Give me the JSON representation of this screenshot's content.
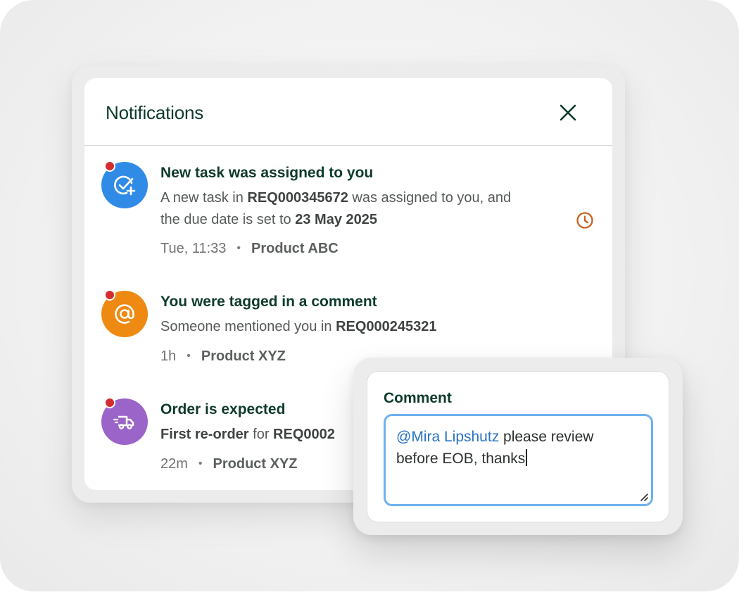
{
  "notifications_panel": {
    "title": "Notifications",
    "close_icon": "close-icon",
    "items": [
      {
        "icon": "task-check-add-icon",
        "icon_color": "#2f8be6",
        "unread": true,
        "title": "New task was assigned to you",
        "body_line1_prefix": "A new task in ",
        "body_line1_ref": "REQ000345672",
        "body_line1_suffix": " was assigned to you, and",
        "body_line2_prefix": "the due date is set to ",
        "body_line2_date": "23 May 2025",
        "time": "Tue, 11:33",
        "separator": "•",
        "product": "Product ABC",
        "status_icon": "clock-icon",
        "status_color": "#c9621c"
      },
      {
        "icon": "at-sign-icon",
        "icon_color": "#ee8a12",
        "unread": true,
        "title": "You were tagged in a comment",
        "body_prefix": "Someone mentioned you in ",
        "body_ref": "REQ000245321",
        "time": "1h",
        "separator": "•",
        "product": "Product XYZ"
      },
      {
        "icon": "delivery-truck-icon",
        "icon_color": "#9b64c9",
        "unread": true,
        "title": "Order is expected",
        "body_bold": "First re-order",
        "body_mid": " for ",
        "body_ref": "REQ0002",
        "time": "22m",
        "separator": "•",
        "product": "Product XYZ"
      }
    ]
  },
  "comment_card": {
    "label": "Comment",
    "mention": "@Mira Lipshutz",
    "text_line1": " please review",
    "text_line2": "before EOB, thanks",
    "focus_border_color": "#6db1ee",
    "resize_icon": "resize-handle-icon"
  },
  "colors": {
    "unread_dot": "#d32d2d",
    "heading": "#0e3a2c",
    "mention_link": "#2a73c5"
  }
}
